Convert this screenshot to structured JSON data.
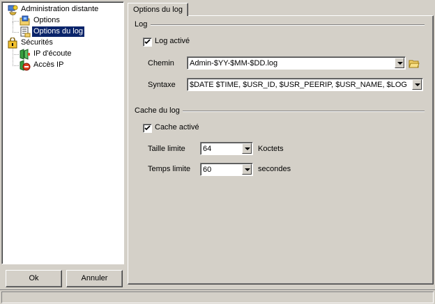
{
  "tree": {
    "items": [
      {
        "label": "Administration distante",
        "icon": "remote-admin-icon"
      },
      {
        "label": "Options",
        "icon": "options-folder-icon"
      },
      {
        "label": "Options du log",
        "icon": "log-options-icon",
        "selected": true
      },
      {
        "label": "Sécurités",
        "icon": "security-icon"
      },
      {
        "label": "IP d'écoute",
        "icon": "listen-ip-icon"
      },
      {
        "label": "Accès IP",
        "icon": "ip-access-icon"
      }
    ]
  },
  "buttons": {
    "ok": "Ok",
    "cancel": "Annuler"
  },
  "tab": {
    "label": "Options du log"
  },
  "log": {
    "group_label": "Log",
    "enabled_label": "Log activé",
    "enabled": true,
    "path_label": "Chemin",
    "path_value": "Admin-$YY-$MM-$DD.log",
    "syntax_label": "Syntaxe",
    "syntax_value": "$DATE $TIME, $USR_ID, $USR_PEERIP, $USR_NAME, $LOG"
  },
  "cache": {
    "group_label": "Cache du log",
    "enabled_label": "Cache activé",
    "enabled": true,
    "size_label": "Taille limite",
    "size_value": "64",
    "size_unit": "Koctets",
    "time_label": "Temps limite",
    "time_value": "60",
    "time_unit": "secondes"
  }
}
